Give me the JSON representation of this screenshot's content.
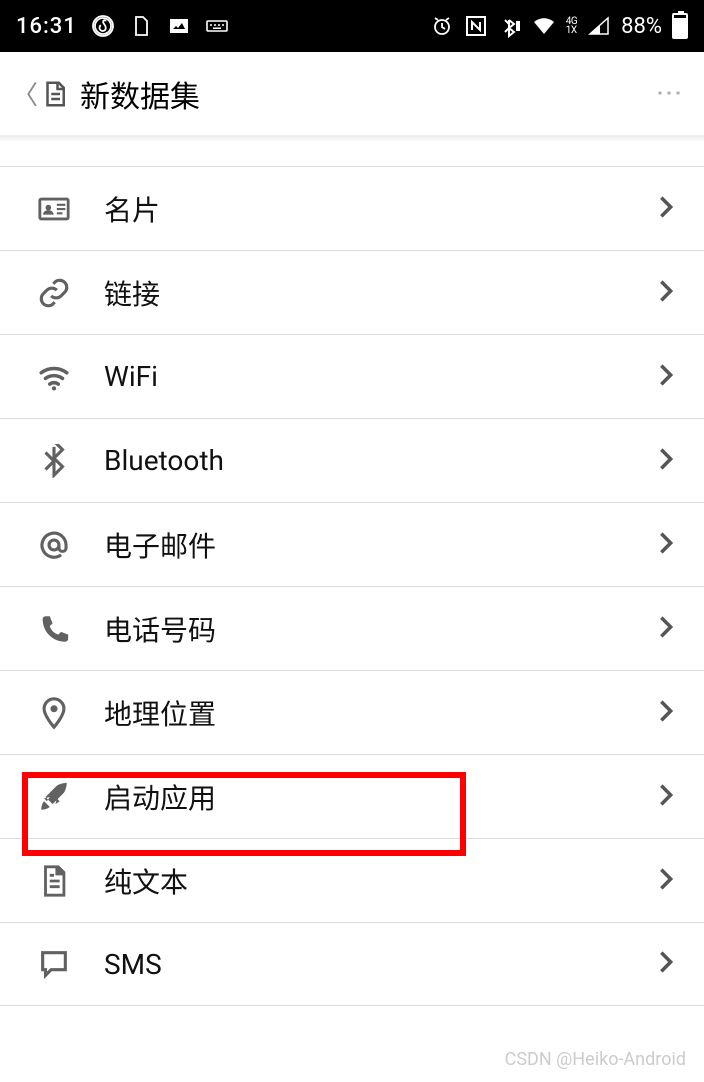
{
  "status": {
    "time": "16:31",
    "network": "4G",
    "network2": "1X",
    "battery": "88%"
  },
  "header": {
    "title": "新数据集"
  },
  "list": [
    {
      "icon": "card-icon",
      "label": "名片"
    },
    {
      "icon": "link-icon",
      "label": "链接"
    },
    {
      "icon": "wifi-icon",
      "label": "WiFi"
    },
    {
      "icon": "bluetooth-icon",
      "label": "Bluetooth"
    },
    {
      "icon": "at-icon",
      "label": "电子邮件"
    },
    {
      "icon": "phone-icon",
      "label": "电话号码"
    },
    {
      "icon": "location-icon",
      "label": "地理位置"
    },
    {
      "icon": "rocket-icon",
      "label": "启动应用",
      "highlighted": true
    },
    {
      "icon": "document-icon",
      "label": "纯文本"
    },
    {
      "icon": "chat-icon",
      "label": "SMS"
    }
  ],
  "watermark": "CSDN @Heiko-Android"
}
